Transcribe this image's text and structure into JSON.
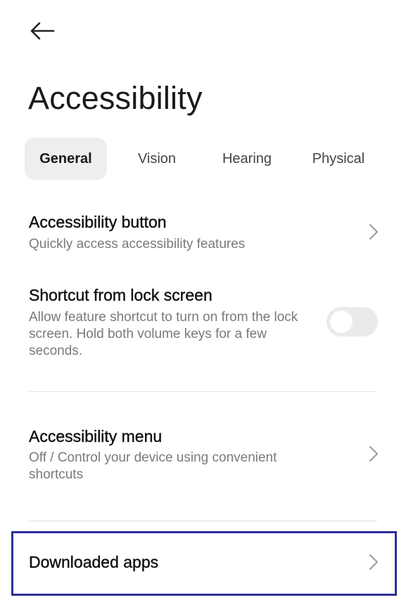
{
  "header": {
    "back_icon": "arrow-left-icon",
    "title": "Accessibility"
  },
  "tabs": [
    {
      "label": "General",
      "active": true
    },
    {
      "label": "Vision",
      "active": false
    },
    {
      "label": "Hearing",
      "active": false
    },
    {
      "label": "Physical",
      "active": false
    }
  ],
  "settings": {
    "accessibility_button": {
      "title": "Accessibility button",
      "subtitle": "Quickly access accessibility features",
      "icon": "chevron-right-icon"
    },
    "shortcut_lock_screen": {
      "title": "Shortcut from lock screen",
      "subtitle": "Allow feature shortcut to turn on from the lock screen. Hold both volume keys for a few seconds.",
      "toggle_on": false
    },
    "accessibility_menu": {
      "title": "Accessibility menu",
      "subtitle": "Off / Control your device using convenient shortcuts",
      "icon": "chevron-right-icon"
    },
    "downloaded_apps": {
      "title": "Downloaded apps",
      "icon": "chevron-right-icon"
    }
  },
  "colors": {
    "highlight_border": "#2b2f9a",
    "active_tab_bg": "#eeeeee",
    "toggle_off_track": "#eaeaea"
  }
}
